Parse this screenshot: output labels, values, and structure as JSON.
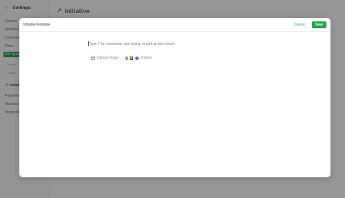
{
  "settings": {
    "back_icon": "chevron-left-icon",
    "title": "Settings",
    "items": [
      "General",
      "Members",
      "Customers",
      "Plans",
      "Doc types"
    ],
    "active": "Doc types",
    "sub_items": [
      "Feedb...",
      "Insigh..."
    ],
    "initiative_label": "Initiatives",
    "more_items": [
      "Properties",
      "Mezercix",
      "Integrations"
    ]
  },
  "page": {
    "title": "Initiative",
    "icon": "trending-up-icon"
  },
  "modal": {
    "title": "Initiative template",
    "cancel_label": "Cancel",
    "save_label": "Save",
    "editor_placeholder": "Type '/' for comments, start typing, or pick an item below",
    "upload_label": "Upload image",
    "embed_label": "Embed"
  },
  "colors": {
    "accent": "#20a84a",
    "active_bg": "#2f9a4e"
  }
}
